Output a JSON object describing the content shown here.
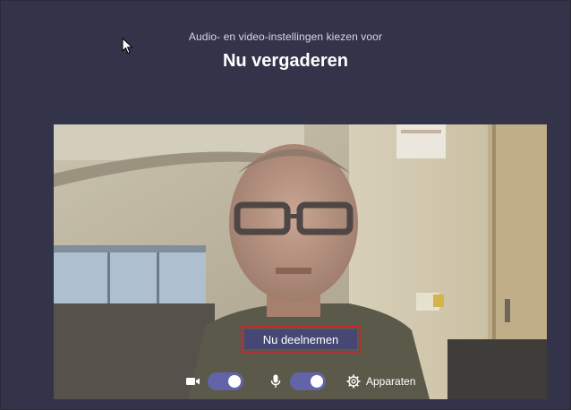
{
  "header": {
    "subtitle": "Audio- en video-instellingen kiezen voor",
    "title": "Nu vergaderen"
  },
  "actions": {
    "join_label": "Nu deelnemen"
  },
  "controls": {
    "camera_on": true,
    "microphone_on": true,
    "devices_label": "Apparaten"
  },
  "colors": {
    "background": "#33344a",
    "accent": "#6264a7",
    "button": "#464775",
    "highlight_border": "#c4262e"
  }
}
